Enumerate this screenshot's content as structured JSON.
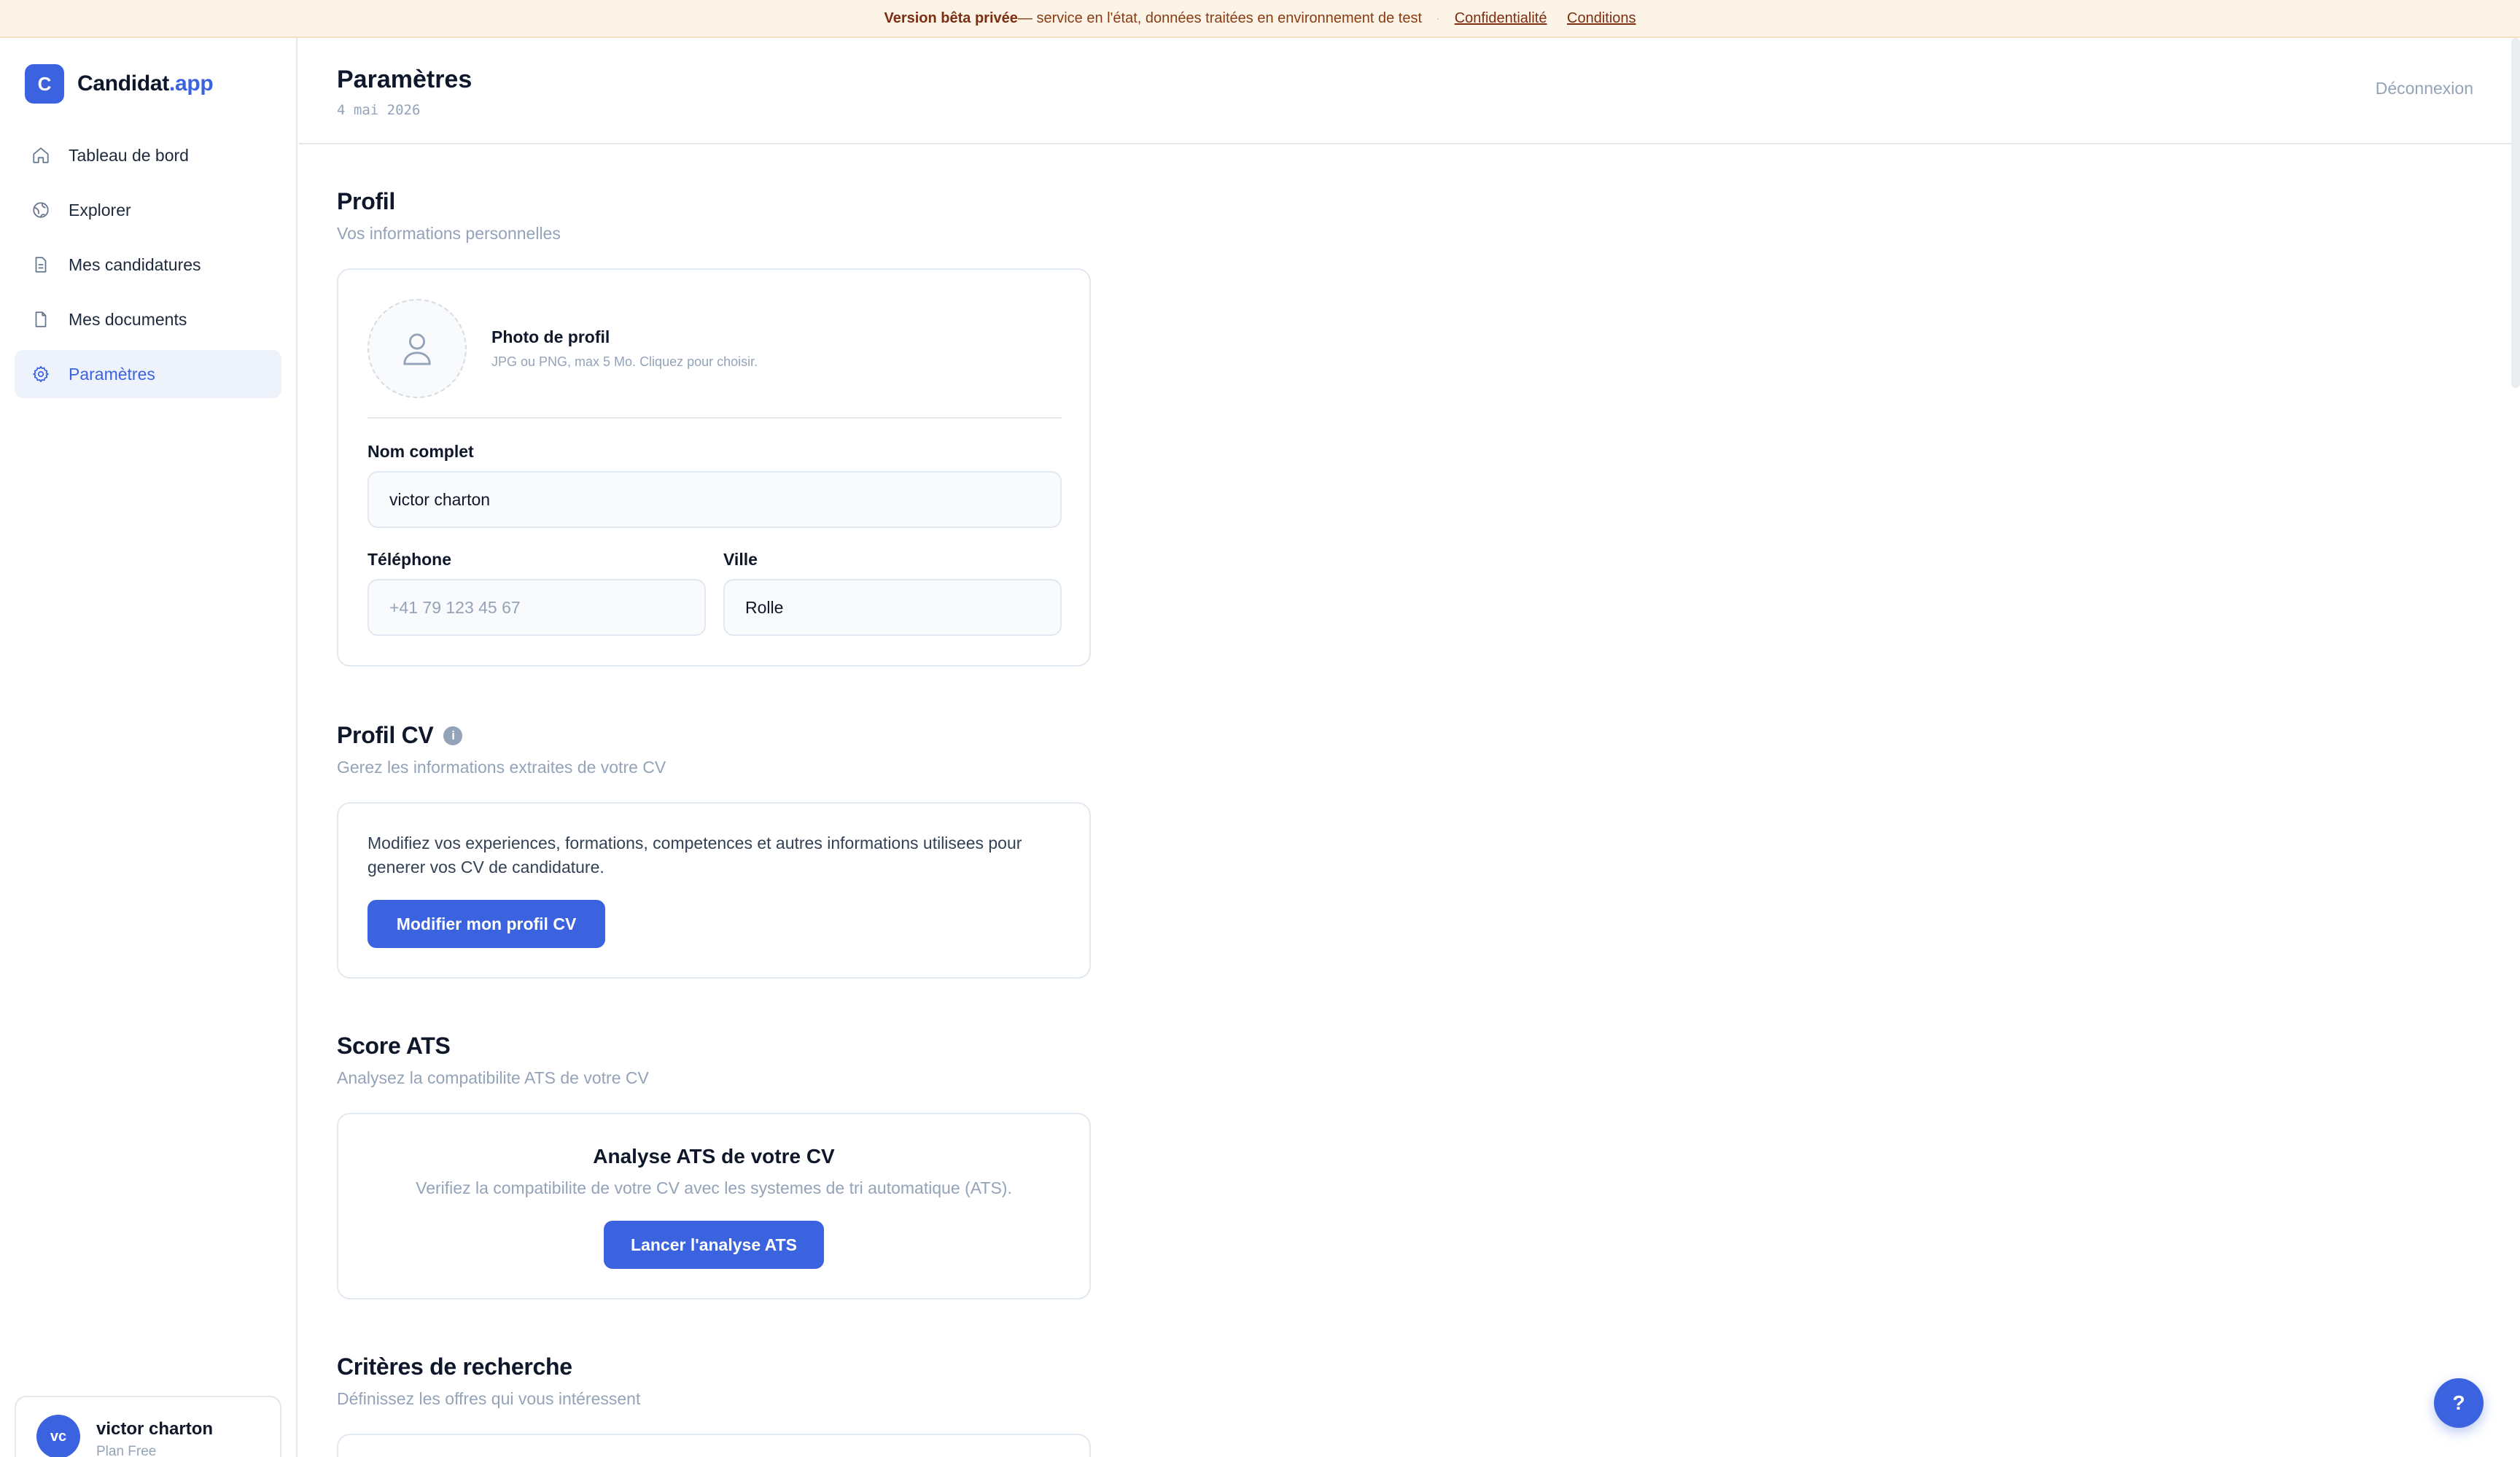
{
  "banner": {
    "strong": "Version bêta privée",
    "text": "— service en l'état, données traitées en environnement de test",
    "separator": "·",
    "privacy_link": "Confidentialité",
    "terms_link": "Conditions"
  },
  "brand": {
    "logo_letter": "C",
    "name": "Candidat",
    "suffix": ".app"
  },
  "sidebar": {
    "items": [
      {
        "label": "Tableau de bord",
        "icon": "home-icon"
      },
      {
        "label": "Explorer",
        "icon": "globe-icon"
      },
      {
        "label": "Mes candidatures",
        "icon": "file-text-icon"
      },
      {
        "label": "Mes documents",
        "icon": "document-icon"
      },
      {
        "label": "Paramètres",
        "icon": "gear-icon",
        "active": true
      }
    ],
    "user": {
      "initials": "vc",
      "name": "victor charton",
      "plan": "Plan Free"
    }
  },
  "header": {
    "title": "Paramètres",
    "date": "4 mai 2026",
    "logout": "Déconnexion"
  },
  "profile": {
    "title": "Profil",
    "subtitle": "Vos informations personnelles",
    "photo_title": "Photo de profil",
    "photo_hint": "JPG ou PNG, max 5 Mo. Cliquez pour choisir.",
    "full_name_label": "Nom complet",
    "full_name_value": "victor charton",
    "phone_label": "Téléphone",
    "phone_placeholder": "+41 79 123 45 67",
    "city_label": "Ville",
    "city_value": "Rolle"
  },
  "cv_profile": {
    "title": "Profil CV",
    "info_glyph": "i",
    "subtitle": "Gerez les informations extraites de votre CV",
    "text": "Modifiez vos experiences, formations, competences et autres informations utilisees pour generer vos CV de candidature.",
    "button": "Modifier mon profil CV"
  },
  "ats": {
    "title": "Score ATS",
    "subtitle": "Analysez la compatibilite ATS de votre CV",
    "card_title": "Analyse ATS de votre CV",
    "card_text": "Verifiez la compatibilite de votre CV avec les systemes de tri automatique (ATS).",
    "button": "Lancer l'analyse ATS"
  },
  "criteria": {
    "title": "Critères de recherche",
    "subtitle": "Définissez les offres qui vous intéressent"
  },
  "help": {
    "label": "?"
  },
  "colors": {
    "accent": "#3b63e0",
    "banner_bg": "#fdf4e8",
    "banner_text": "#7c2d12",
    "muted": "#94a3b8"
  }
}
